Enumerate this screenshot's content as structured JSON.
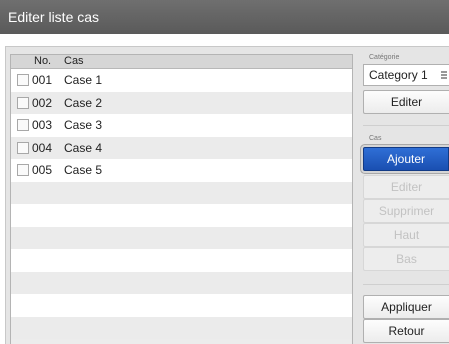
{
  "window": {
    "title": "Editer liste cas"
  },
  "list": {
    "headers": {
      "no": "No.",
      "cas": "Cas"
    },
    "rows": [
      {
        "no": "001",
        "name": "Case 1"
      },
      {
        "no": "002",
        "name": "Case 2"
      },
      {
        "no": "003",
        "name": "Case 3"
      },
      {
        "no": "004",
        "name": "Case 4"
      },
      {
        "no": "005",
        "name": "Case 5"
      },
      {
        "no": "",
        "name": ""
      },
      {
        "no": "",
        "name": ""
      },
      {
        "no": "",
        "name": ""
      },
      {
        "no": "",
        "name": ""
      },
      {
        "no": "",
        "name": ""
      },
      {
        "no": "",
        "name": ""
      },
      {
        "no": "",
        "name": ""
      }
    ]
  },
  "category": {
    "label": "Catégorie",
    "selected": "Category 1",
    "edit_label": "Editer"
  },
  "cas": {
    "label": "Cas",
    "add_label": "Ajouter",
    "edit_label": "Editer",
    "delete_label": "Supprimer",
    "up_label": "Haut",
    "down_label": "Bas"
  },
  "footer": {
    "apply_label": "Appliquer",
    "back_label": "Retour"
  }
}
